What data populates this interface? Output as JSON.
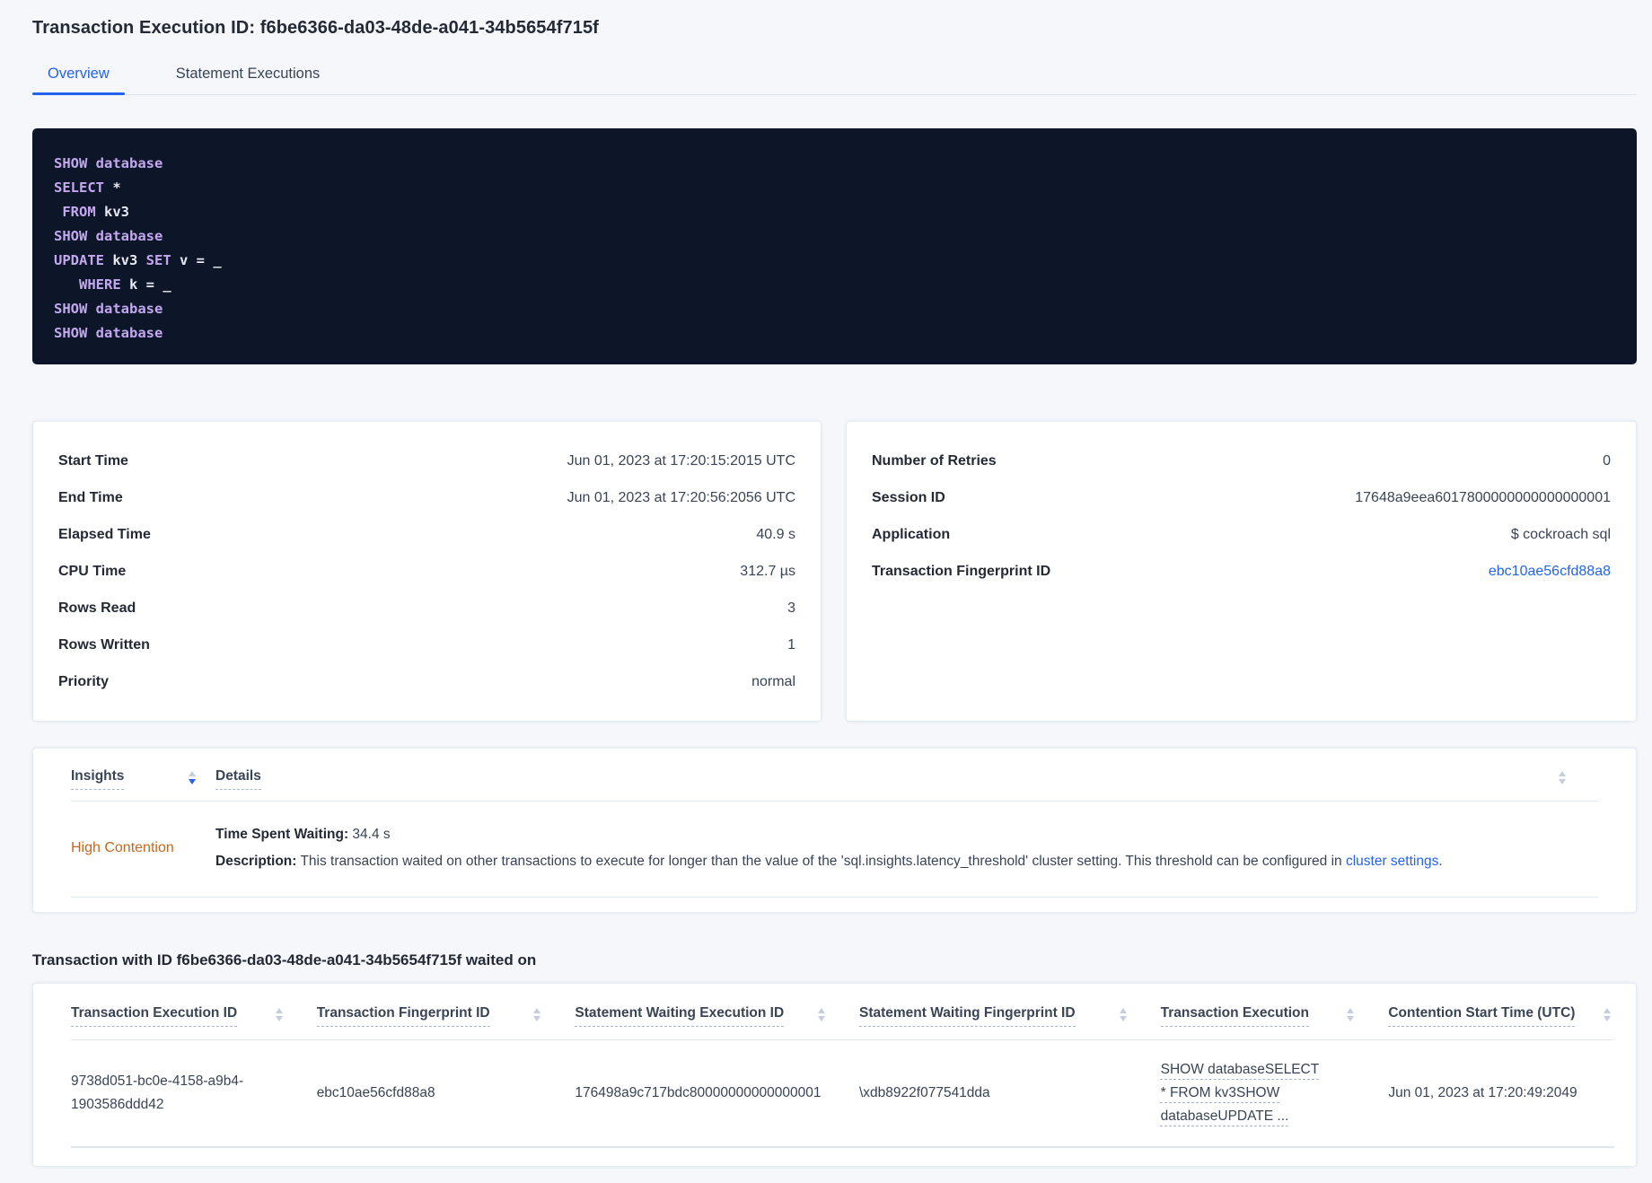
{
  "page": {
    "title": "Transaction Execution ID: f6be6366-da03-48de-a041-34b5654f715f"
  },
  "tabs": [
    {
      "label": "Overview",
      "active": true
    },
    {
      "label": "Statement Executions",
      "active": false
    }
  ],
  "sql_box": {
    "lines": [
      [
        {
          "c": "kw",
          "t": "SHOW"
        },
        {
          "c": "pl",
          "t": " "
        },
        {
          "c": "kw",
          "t": "database"
        }
      ],
      [
        {
          "c": "kw",
          "t": "SELECT"
        },
        {
          "c": "pl",
          "t": " *"
        }
      ],
      [
        {
          "c": "pl",
          "t": " "
        },
        {
          "c": "kw",
          "t": "FROM"
        },
        {
          "c": "pl",
          "t": " kv3"
        }
      ],
      [
        {
          "c": "kw",
          "t": "SHOW"
        },
        {
          "c": "pl",
          "t": " "
        },
        {
          "c": "kw",
          "t": "database"
        }
      ],
      [
        {
          "c": "kw",
          "t": "UPDATE"
        },
        {
          "c": "pl",
          "t": " kv3 "
        },
        {
          "c": "kw",
          "t": "SET"
        },
        {
          "c": "pl",
          "t": " v = _"
        }
      ],
      [
        {
          "c": "pl",
          "t": "   "
        },
        {
          "c": "kw",
          "t": "WHERE"
        },
        {
          "c": "pl",
          "t": " k = _"
        }
      ],
      [
        {
          "c": "kw",
          "t": "SHOW"
        },
        {
          "c": "pl",
          "t": " "
        },
        {
          "c": "kw",
          "t": "database"
        }
      ],
      [
        {
          "c": "kw",
          "t": "SHOW"
        },
        {
          "c": "pl",
          "t": " "
        },
        {
          "c": "kw",
          "t": "database"
        }
      ]
    ]
  },
  "summary_left": {
    "rows": [
      {
        "label": "Start Time",
        "value": "Jun 01, 2023 at 17:20:15:2015 UTC"
      },
      {
        "label": "End Time",
        "value": "Jun 01, 2023 at 17:20:56:2056 UTC"
      },
      {
        "label": "Elapsed Time",
        "value": "40.9 s"
      },
      {
        "label": "CPU Time",
        "value": "312.7 µs"
      },
      {
        "label": "Rows Read",
        "value": "3"
      },
      {
        "label": "Rows Written",
        "value": "1"
      },
      {
        "label": "Priority",
        "value": "normal"
      }
    ]
  },
  "summary_right": {
    "rows": [
      {
        "label": "Number of Retries",
        "value": "0"
      },
      {
        "label": "Session ID",
        "value": "17648a9eea6017800000000000000001"
      },
      {
        "label": "Application",
        "value": "$ cockroach sql"
      },
      {
        "label": "Transaction Fingerprint ID",
        "value": "ebc10ae56cfd88a8"
      }
    ]
  },
  "insights": {
    "col_insights": "Insights",
    "col_details": "Details",
    "row": {
      "insight": "High Contention",
      "waiting_label": "Time Spent Waiting:",
      "waiting_value": " 34.4 s",
      "desc_label": "Description:",
      "desc_text": " This transaction waited on other transactions to execute for longer than the value of the 'sql.insights.latency_threshold' cluster setting. This threshold can be configured in ",
      "desc_link": "cluster settings",
      "desc_suffix": "."
    }
  },
  "waited": {
    "heading": "Transaction with ID f6be6366-da03-48de-a041-34b5654f715f waited on",
    "columns": [
      "Transaction Execution ID",
      "Transaction Fingerprint ID",
      "Statement Waiting Execution ID",
      "Statement Waiting Fingerprint ID",
      "Transaction Execution",
      "Contention Start Time (UTC)"
    ],
    "rows": [
      {
        "txn_exec_id": "9738d051-bc0e-4158-a9b4-1903586ddd42",
        "txn_fp_id": "ebc10ae56cfd88a8",
        "stmt_wait_exec_id": "176498a9c717bdc80000000000000001",
        "stmt_wait_fp_id": "\\xdb8922f077541dda",
        "txn_execution": "SHOW databaseSELECT * FROM kv3SHOW databaseUPDATE ...",
        "contention_start": "Jun 01, 2023 at 17:20:49:2049"
      }
    ]
  },
  "colors": {
    "accent_blue": "#2563ee",
    "insight_orange": "#c2691e",
    "code_bg": "#0d1628",
    "code_keyword": "#c3a8f0",
    "code_text": "#e7e9f2",
    "page_bg": "#f5f7fa"
  }
}
